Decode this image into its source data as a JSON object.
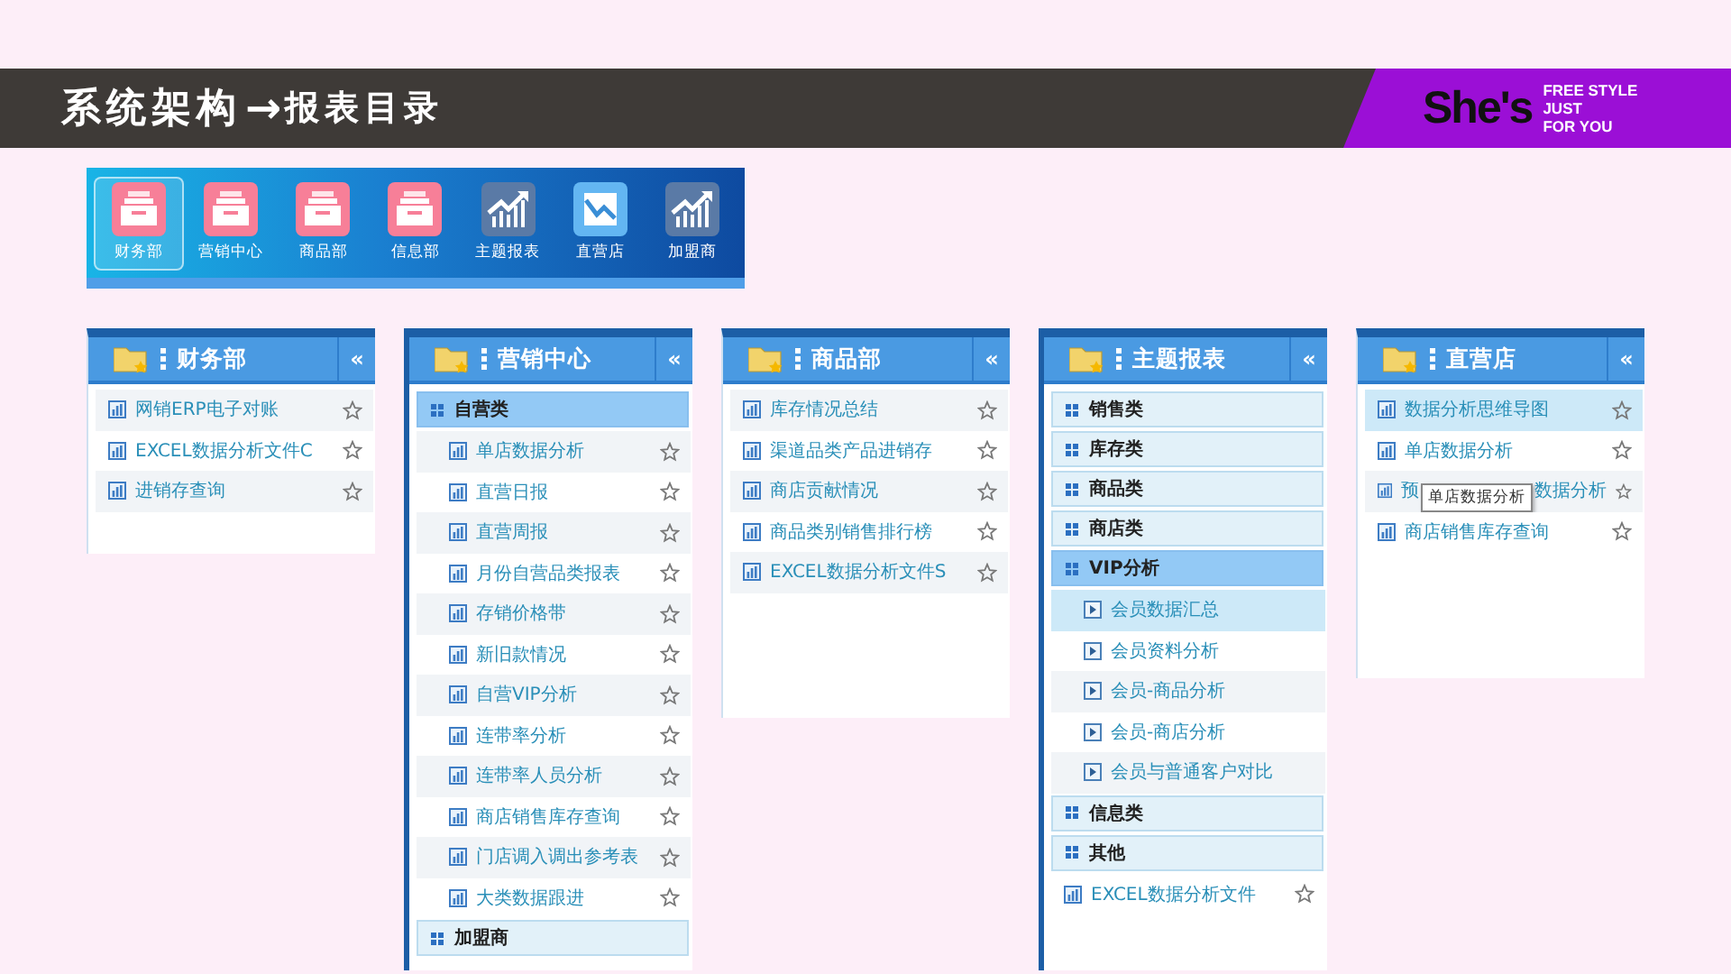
{
  "header": {
    "title": "系统架构",
    "arrow": "→",
    "subtitle": "报表目录",
    "logo": {
      "brand": "She's",
      "slogan": [
        "FREE STYLE",
        "JUST",
        "FOR YOU"
      ]
    }
  },
  "toolbar": [
    {
      "label": "财务部",
      "kind": "inbox",
      "selected": true
    },
    {
      "label": "营销中心",
      "kind": "inbox",
      "selected": false
    },
    {
      "label": "商品部",
      "kind": "inbox",
      "selected": false
    },
    {
      "label": "信息部",
      "kind": "inbox",
      "selected": false
    },
    {
      "label": "主题报表",
      "kind": "trend",
      "selected": false
    },
    {
      "label": "直营店",
      "kind": "chart",
      "selected": false
    },
    {
      "label": "加盟商",
      "kind": "trend",
      "selected": false
    }
  ],
  "panels": [
    {
      "title": "财务部",
      "collapse": "«",
      "items": [
        {
          "kind": "report",
          "label": "网销ERP电子对账",
          "selected": false
        },
        {
          "kind": "report",
          "label": "EXCEL数据分析文件C",
          "selected": false
        },
        {
          "kind": "report",
          "label": "进销存查询",
          "selected": false
        }
      ]
    },
    {
      "title": "营销中心",
      "collapse": "«",
      "items": [
        {
          "kind": "group",
          "label": "自营类",
          "selected": true,
          "children": [
            {
              "kind": "report",
              "label": "单店数据分析",
              "selected": false
            },
            {
              "kind": "report",
              "label": "直营日报",
              "selected": false
            },
            {
              "kind": "report",
              "label": "直营周报",
              "selected": false
            },
            {
              "kind": "report",
              "label": "月份自营品类报表",
              "selected": false
            },
            {
              "kind": "report",
              "label": "存销价格带",
              "selected": false
            },
            {
              "kind": "report",
              "label": "新旧款情况",
              "selected": false
            },
            {
              "kind": "report",
              "label": "自营VIP分析",
              "selected": false
            },
            {
              "kind": "report",
              "label": "连带率分析",
              "selected": false
            },
            {
              "kind": "report",
              "label": "连带率人员分析",
              "selected": false
            },
            {
              "kind": "report",
              "label": "商店销售库存查询",
              "selected": false
            },
            {
              "kind": "report",
              "label": "门店调入调出参考表",
              "selected": false
            },
            {
              "kind": "report",
              "label": "大类数据跟进",
              "selected": false
            }
          ]
        },
        {
          "kind": "group",
          "label": "加盟商",
          "selected": false
        }
      ]
    },
    {
      "title": "商品部",
      "collapse": "«",
      "items": [
        {
          "kind": "report",
          "label": "库存情况总结",
          "selected": false
        },
        {
          "kind": "report",
          "label": "渠道品类产品进销存",
          "selected": false
        },
        {
          "kind": "report",
          "label": "商店贡献情况",
          "selected": false
        },
        {
          "kind": "report",
          "label": "商品类别销售排行榜",
          "selected": false
        },
        {
          "kind": "report",
          "label": "EXCEL数据分析文件S",
          "selected": false
        }
      ]
    },
    {
      "title": "主题报表",
      "collapse": "«",
      "items": [
        {
          "kind": "group",
          "label": "销售类",
          "selected": false
        },
        {
          "kind": "group",
          "label": "库存类",
          "selected": false
        },
        {
          "kind": "group",
          "label": "商品类",
          "selected": false
        },
        {
          "kind": "group",
          "label": "商店类",
          "selected": false
        },
        {
          "kind": "group",
          "label": "VIP分析",
          "selected": true,
          "children": [
            {
              "kind": "sub",
              "label": "会员数据汇总",
              "selected": true
            },
            {
              "kind": "sub",
              "label": "会员资料分析",
              "selected": false
            },
            {
              "kind": "sub",
              "label": "会员-商品分析",
              "selected": false
            },
            {
              "kind": "sub",
              "label": "会员-商店分析",
              "selected": false
            },
            {
              "kind": "sub",
              "label": "会员与普通客户对比",
              "selected": false
            }
          ]
        },
        {
          "kind": "group",
          "label": "信息类",
          "selected": false
        },
        {
          "kind": "group",
          "label": "其他",
          "selected": false
        },
        {
          "kind": "report",
          "label": "EXCEL数据分析文件",
          "selected": false
        }
      ]
    },
    {
      "title": "直营店",
      "collapse": "«",
      "items": [
        {
          "kind": "report",
          "label": "数据分析思维导图",
          "selected": true
        },
        {
          "kind": "report",
          "label": "单店数据分析",
          "selected": false
        },
        {
          "kind": "report",
          "label": "预",
          "label_end": "数据分析",
          "tooltip": "单店数据分析",
          "selected": false
        },
        {
          "kind": "report",
          "label": "商店销售库存查询",
          "selected": false
        }
      ]
    }
  ]
}
